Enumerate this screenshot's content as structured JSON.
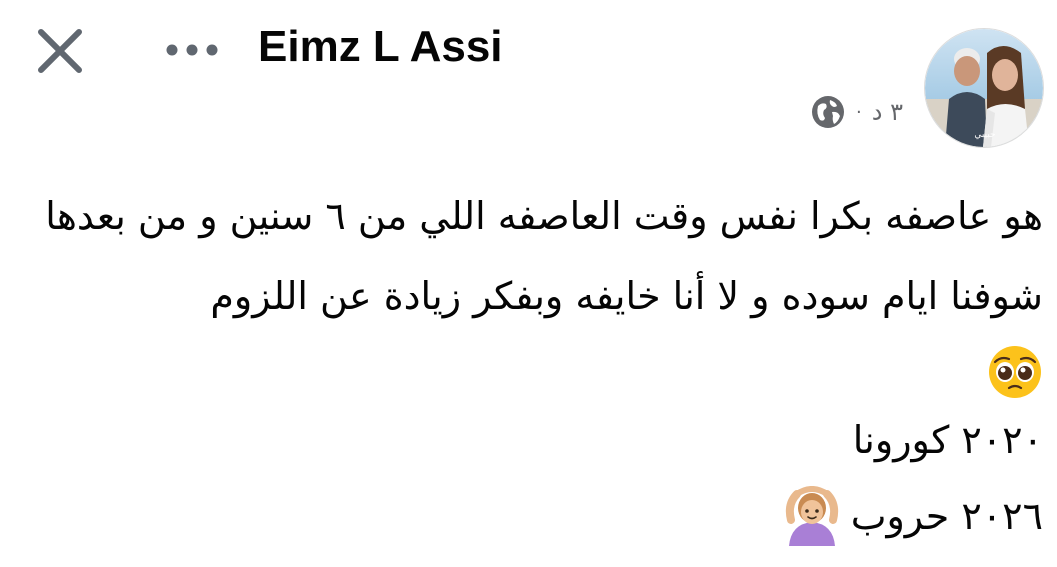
{
  "header": {
    "author_name": "Eimz L Assi",
    "close_icon": "close-icon",
    "more_icon": "more-horizontal-icon"
  },
  "meta": {
    "time": "٣ د",
    "separator": "·",
    "privacy_icon": "globe-icon"
  },
  "avatar": {
    "caption": "حبيبي",
    "icon": "avatar"
  },
  "post": {
    "paragraph": "هو عاصفه بكرا نفس وقت العاصفه اللي من ٦ سنين و من بعدها شوفنا ايام سوده و لا أنا خايفه وبفكر زيادة عن اللزوم",
    "emoji_1": "pleading-face-emoji",
    "line_2": "٢٠٢٠ كورونا",
    "line_3": "٢٠٢٦ حروب",
    "emoji_2": "person-gesturing-ok-emoji"
  },
  "colors": {
    "text_primary": "#050505",
    "text_secondary": "#65676b",
    "icon_gray": "#606770",
    "background": "#ffffff"
  }
}
